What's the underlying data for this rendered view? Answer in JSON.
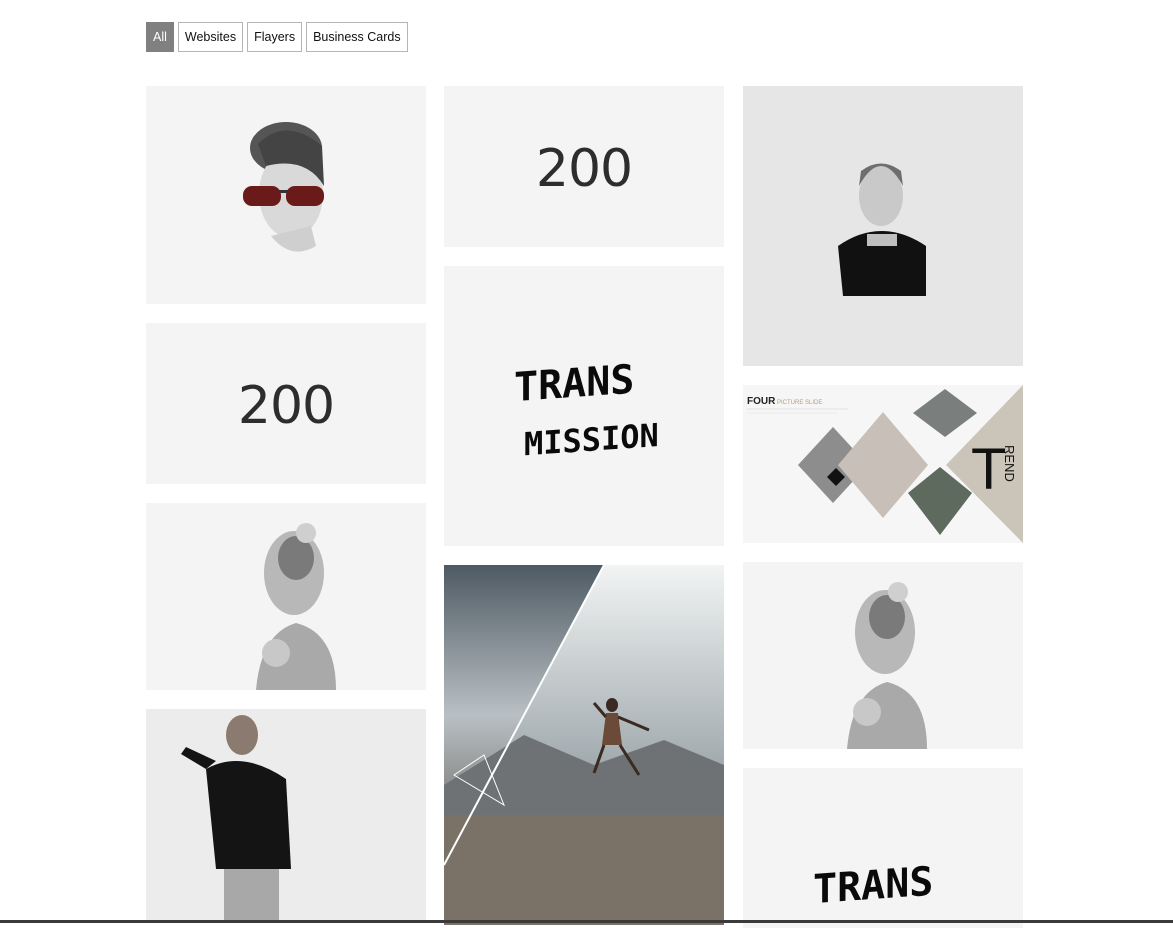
{
  "filters": [
    {
      "label": "All",
      "active": true
    },
    {
      "label": "Websites",
      "active": false
    },
    {
      "label": "Flayers",
      "active": false
    },
    {
      "label": "Business Cards",
      "active": false
    }
  ],
  "gallery": {
    "number_200": "200",
    "transmission": {
      "line1": "TRANS",
      "line2": "MISSION"
    },
    "four_slide": {
      "title": "FOUR",
      "subtitle": "PICTURE SLIDE",
      "trend_big": "T",
      "trend_rest": "REND"
    }
  }
}
